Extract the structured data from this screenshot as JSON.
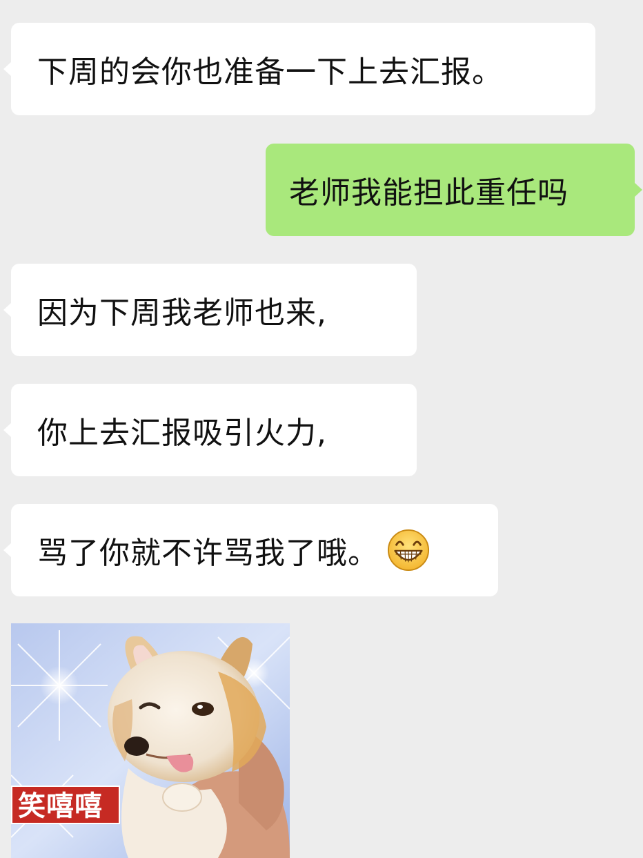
{
  "messages": [
    {
      "side": "left",
      "text": "下周的会你也准备一下上去汇报。"
    },
    {
      "side": "right",
      "text": "老师我能担此重任吗"
    },
    {
      "side": "left",
      "text": "因为下周我老师也来,"
    },
    {
      "side": "left",
      "text": "你上去汇报吸引火力,"
    },
    {
      "side": "left",
      "text": "骂了你就不许骂我了哦。",
      "emoji": "grin-face-icon"
    }
  ],
  "sticker": {
    "caption": "笑嘻嘻",
    "subject": "chihuahua-puppy-held-in-hand"
  },
  "colors": {
    "background": "#ededed",
    "incoming_bubble": "#ffffff",
    "outgoing_bubble": "#a9e87c",
    "sticker_caption_bg": "#c62a23"
  }
}
